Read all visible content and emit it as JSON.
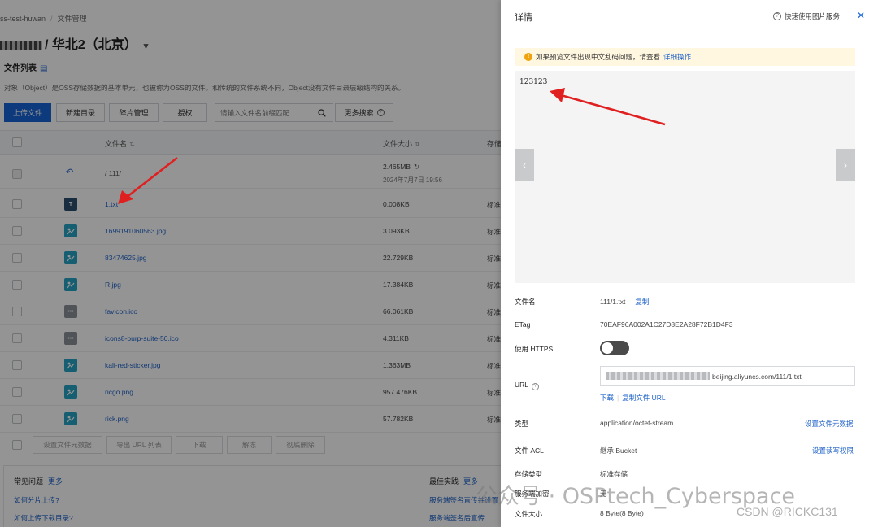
{
  "breadcrumb": {
    "bucket": "ss-test-huwan",
    "current": "文件管理"
  },
  "region_title": "/ 华北2（北京）",
  "file_list": {
    "title": "文件列表",
    "description": "对象（Object）是OSS存储数据的基本单元，也被称为OSS的文件。和传统的文件系统不同，Object没有文件目录层级结构的关系。"
  },
  "toolbar": {
    "upload": "上传文件",
    "new_dir": "新建目录",
    "fragment": "碎片管理",
    "authorize": "授权",
    "search_placeholder": "请输入文件名前缀匹配",
    "more_search": "更多搜索"
  },
  "table": {
    "headers": {
      "name": "文件名",
      "size": "文件大小",
      "storage": "存储"
    },
    "parent_row": {
      "name": "/ 111/",
      "size": "2.465MB",
      "date": "2024年7月7日 19:56"
    },
    "rows": [
      {
        "name": "1.txt",
        "size": "0.008KB",
        "type": "标准",
        "thumb": "txt"
      },
      {
        "name": "1699191060563.jpg",
        "size": "3.093KB",
        "type": "标准",
        "thumb": "img"
      },
      {
        "name": "83474625.jpg",
        "size": "22.729KB",
        "type": "标准",
        "thumb": "img"
      },
      {
        "name": "R.jpg",
        "size": "17.384KB",
        "type": "标准",
        "thumb": "img"
      },
      {
        "name": "favicon.ico",
        "size": "66.061KB",
        "type": "标准",
        "thumb": "ico"
      },
      {
        "name": "icons8-burp-suite-50.ico",
        "size": "4.311KB",
        "type": "标准",
        "thumb": "ico"
      },
      {
        "name": "kali-red-sticker.jpg",
        "size": "1.363MB",
        "type": "标准",
        "thumb": "img"
      },
      {
        "name": "ricgo.png",
        "size": "957.476KB",
        "type": "标准",
        "thumb": "img"
      },
      {
        "name": "rick.png",
        "size": "57.782KB",
        "type": "标准",
        "thumb": "img"
      }
    ],
    "footer_buttons": {
      "set_meta": "设置文件元数据",
      "export_url": "导出 URL 列表",
      "download": "下载",
      "unfreeze": "解冻",
      "delete": "彻底删除"
    }
  },
  "faq": {
    "title": "常见问题",
    "more": "更多",
    "q1": "如何分片上传?",
    "q2": "如何上传下载目录?",
    "best_title": "最佳实践",
    "best_more": "更多",
    "b1": "服务端签名直传并设置",
    "b2": "服务端签名后直传"
  },
  "drawer": {
    "title": "详情",
    "help_link": "快速使用图片服务",
    "notice_text": "如果预览文件出现中文乱码问题，请查看",
    "notice_link": "详细操作",
    "preview_content": "123123",
    "fields": {
      "filename_label": "文件名",
      "filename_value": "111/1.txt",
      "copy": "复制",
      "etag_label": "ETag",
      "etag_value": "70EAF96A002A1C27D8E2A28F72B1D4F3",
      "https_label": "使用 HTTPS",
      "url_label": "URL",
      "url_value": "beijing.aliyuncs.com/111/1.txt",
      "download": "下载",
      "copy_url": "复制文件 URL",
      "type_label": "类型",
      "type_value": "application/octet-stream",
      "set_meta": "设置文件元数据",
      "acl_label": "文件 ACL",
      "acl_value": "继承 Bucket",
      "set_acl": "设置读写权限",
      "storage_label": "存储类型",
      "storage_value": "标准存储",
      "encrypt_label": "服务端加密",
      "encrypt_value": "无",
      "size_label": "文件大小",
      "size_value": "8 Byte(8 Byte)"
    }
  },
  "watermarks": {
    "wechat": "公众号 · OSPtech_Cyberspace",
    "csdn": "CSDN @RICKC131"
  },
  "colors": {
    "primary": "#1665d8",
    "link": "#1e62c8",
    "annotation_arrow": "#e02020",
    "notice_bg": "#fff7e0"
  }
}
